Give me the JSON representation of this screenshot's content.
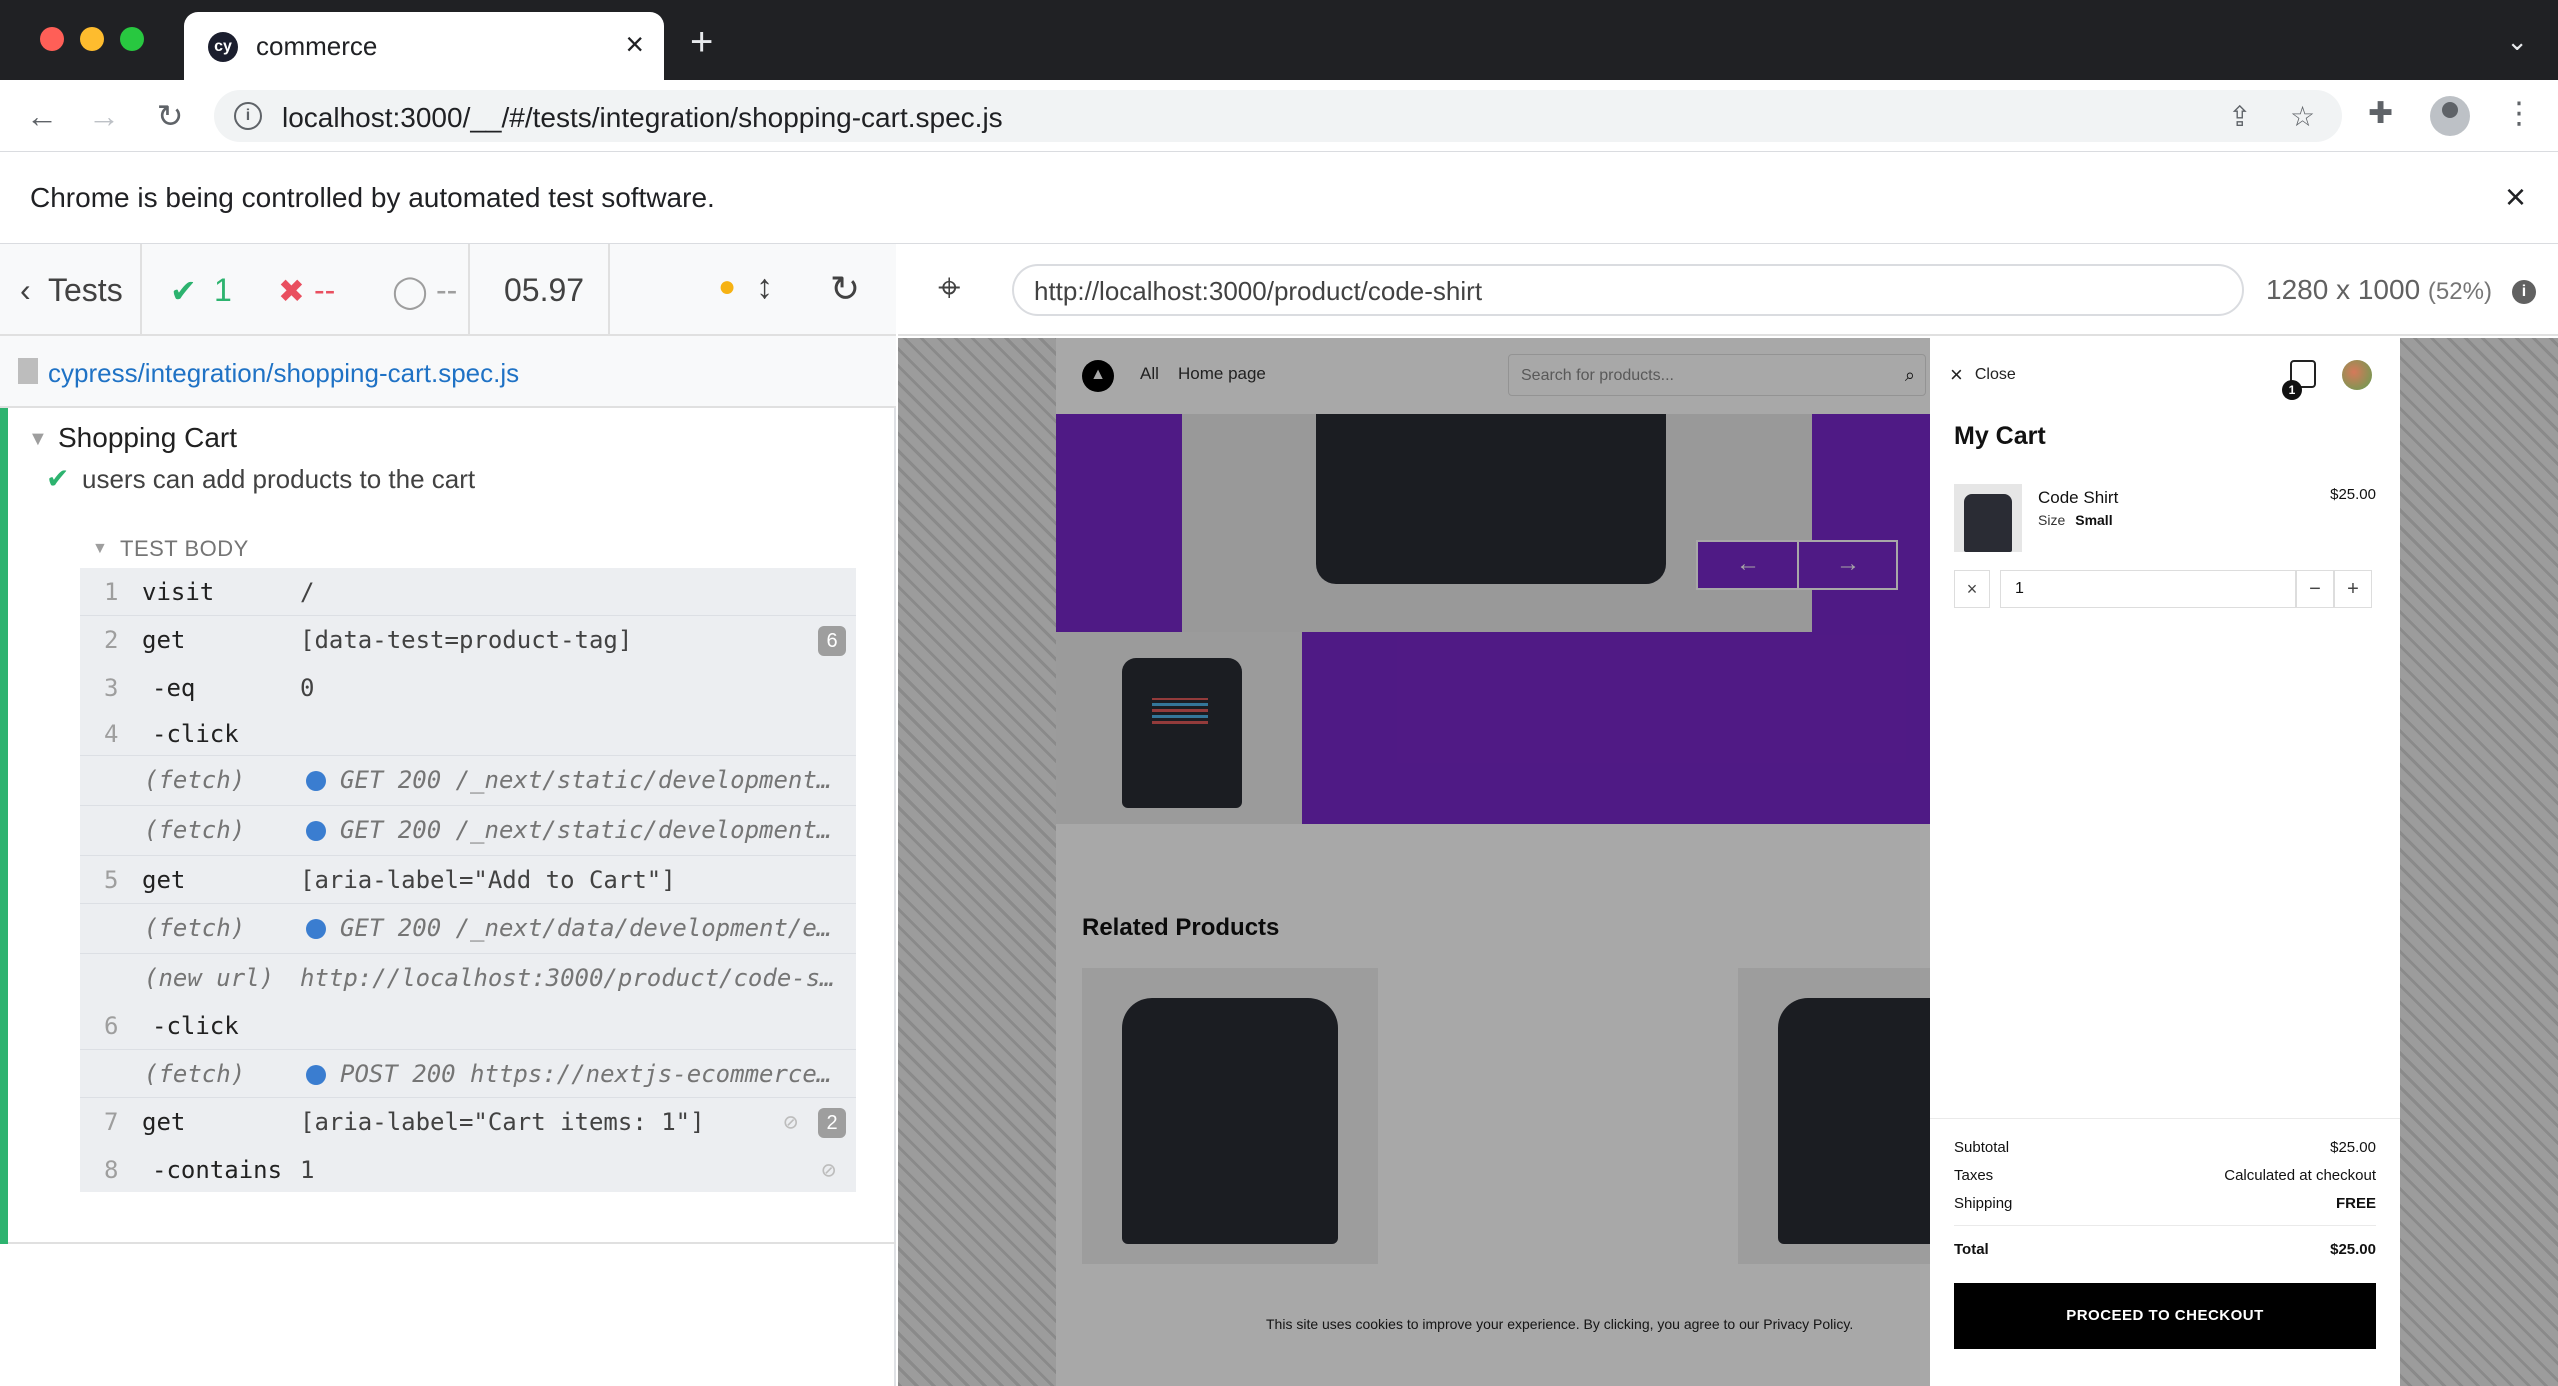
{
  "browser": {
    "tab_title": "commerce",
    "favicon_text": "cy",
    "new_tab_symbol": "+",
    "url": "localhost:3000/__/#/tests/integration/shopping-cart.spec.js",
    "infobar_text": "Chrome is being controlled by automated test software."
  },
  "runner": {
    "tests_label": "Tests",
    "passed": "1",
    "failed": "--",
    "pending": "--",
    "duration": "05.97",
    "spec_path": "cypress/integration/shopping-cart.spec.js",
    "suite_title": "Shopping Cart",
    "test_title": "users can add products to the cart",
    "body_label": "TEST BODY",
    "commands": [
      {
        "num": "1",
        "name": "visit",
        "msg": "/"
      },
      {
        "num": "2",
        "name": "get",
        "msg": "[data-test=product-tag]",
        "badge": "6"
      },
      {
        "num": "3",
        "name": "-eq",
        "msg": "0"
      },
      {
        "num": "4",
        "name": "-click",
        "msg": ""
      },
      {
        "num": "",
        "name": "(fetch)",
        "msg": "GET 200 /_next/static/development…"
      },
      {
        "num": "",
        "name": "(fetch)",
        "msg": "GET 200 /_next/static/development…"
      },
      {
        "num": "5",
        "name": "get",
        "msg": "[aria-label=\"Add to Cart\"]"
      },
      {
        "num": "",
        "name": "(fetch)",
        "msg": "GET 200 /_next/data/development/e…"
      },
      {
        "num": "",
        "name": "(new url)",
        "msg": "http://localhost:3000/product/code-s…"
      },
      {
        "num": "6",
        "name": "-click",
        "msg": ""
      },
      {
        "num": "",
        "name": "(fetch)",
        "msg": "POST 200 https://nextjs-ecommerce…"
      },
      {
        "num": "7",
        "name": "get",
        "msg": "[aria-label=\"Cart items: 1\"]",
        "badge": "2"
      },
      {
        "num": "8",
        "name": "-contains",
        "msg": "1"
      }
    ]
  },
  "aut": {
    "url": "http://localhost:3000/product/code-shirt",
    "viewport": "1280 x 1000",
    "scale": "(52%)"
  },
  "store": {
    "nav_all": "All",
    "nav_home": "Home page",
    "search_placeholder": "Search for products...",
    "related_title": "Related Products",
    "cookie_text": "This site uses cookies to improve your experience. By clicking, you agree to our Privacy Policy."
  },
  "cart": {
    "close_label": "Close",
    "bag_count": "1",
    "title": "My Cart",
    "item_name": "Code Shirt",
    "size_label": "Size",
    "size_value": "Small",
    "item_price": "$25.00",
    "quantity": "1",
    "subtotal_label": "Subtotal",
    "subtotal_value": "$25.00",
    "taxes_label": "Taxes",
    "taxes_value": "Calculated at checkout",
    "shipping_label": "Shipping",
    "shipping_value": "FREE",
    "total_label": "Total",
    "total_value": "$25.00",
    "checkout_label": "PROCEED TO CHECKOUT"
  },
  "colors": {
    "accent_purple": "#7928ca",
    "pass_green": "#2db36f",
    "fail_red": "#e94f5f",
    "link_blue": "#1f72c5"
  }
}
